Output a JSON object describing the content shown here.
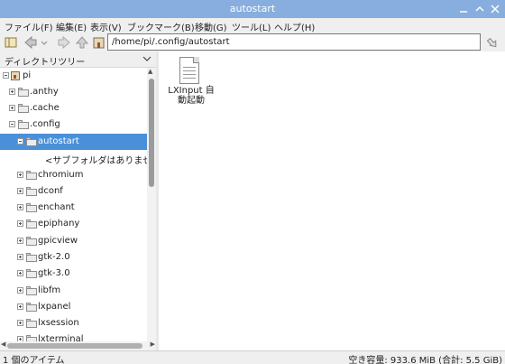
{
  "window": {
    "title": "autostart"
  },
  "menu": [
    "ファイル(F)",
    "編集(E)",
    "表示(V)",
    "ブックマーク(B)",
    "移動(G)",
    "ツール(L)",
    "ヘルプ(H)"
  ],
  "toolbar": {
    "path": "/home/pi/.config/autostart"
  },
  "sidebar": {
    "header": "ディレクトリツリー",
    "tree": [
      {
        "label": "pi",
        "level": 0,
        "icon": "home",
        "expander": "minus"
      },
      {
        "label": ".anthy",
        "level": 1,
        "icon": "folder",
        "expander": "plus"
      },
      {
        "label": ".cache",
        "level": 1,
        "icon": "folder",
        "expander": "plus"
      },
      {
        "label": ".config",
        "level": 1,
        "icon": "folder",
        "expander": "minus"
      },
      {
        "label": "autostart",
        "level": 2,
        "icon": "folder",
        "expander": "minus",
        "selected": true
      },
      {
        "label": "<サブフォルダはありません>",
        "level": 3,
        "icon": "none",
        "expander": "none"
      },
      {
        "label": "chromium",
        "level": 2,
        "icon": "folder",
        "expander": "plus"
      },
      {
        "label": "dconf",
        "level": 2,
        "icon": "folder",
        "expander": "plus"
      },
      {
        "label": "enchant",
        "level": 2,
        "icon": "folder",
        "expander": "plus"
      },
      {
        "label": "epiphany",
        "level": 2,
        "icon": "folder",
        "expander": "plus"
      },
      {
        "label": "gpicview",
        "level": 2,
        "icon": "folder",
        "expander": "plus"
      },
      {
        "label": "gtk-2.0",
        "level": 2,
        "icon": "folder",
        "expander": "plus"
      },
      {
        "label": "gtk-3.0",
        "level": 2,
        "icon": "folder",
        "expander": "plus"
      },
      {
        "label": "libfm",
        "level": 2,
        "icon": "folder",
        "expander": "plus"
      },
      {
        "label": "lxpanel",
        "level": 2,
        "icon": "folder",
        "expander": "plus"
      },
      {
        "label": "lxsession",
        "level": 2,
        "icon": "folder",
        "expander": "plus"
      },
      {
        "label": "lxterminal",
        "level": 2,
        "icon": "folder",
        "expander": "plus"
      }
    ]
  },
  "content": {
    "files": [
      {
        "name": "LXInput 自動起動",
        "icon": "document-icon"
      }
    ]
  },
  "status": {
    "left": "1 個のアイテム",
    "right": "空き容量: 933.6 MiB (合計: 5.5 GiB)"
  },
  "colors": {
    "titlebar": "#87aede",
    "selection": "#4a90d9"
  }
}
